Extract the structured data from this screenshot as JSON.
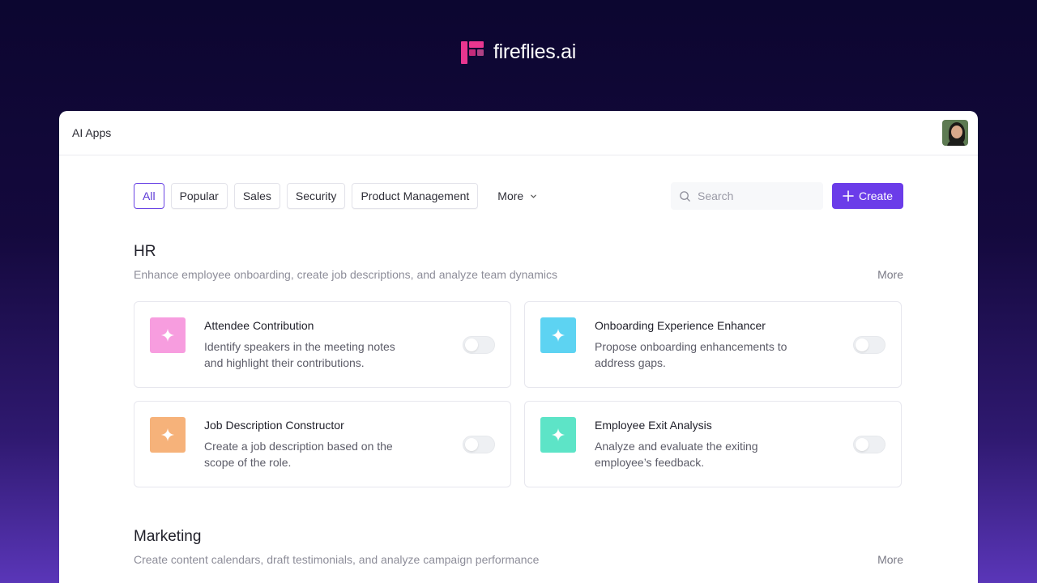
{
  "brand": {
    "name": "fireflies.ai",
    "color": "#e8368f"
  },
  "panel": {
    "title": "AI Apps"
  },
  "filters": {
    "chips": [
      {
        "label": "All",
        "active": true
      },
      {
        "label": "Popular",
        "active": false
      },
      {
        "label": "Sales",
        "active": false
      },
      {
        "label": "Security",
        "active": false
      },
      {
        "label": "Product Management",
        "active": false
      }
    ],
    "more_label": "More"
  },
  "search": {
    "placeholder": "Search",
    "value": ""
  },
  "create": {
    "label": "Create",
    "color": "#6b3ce9"
  },
  "sections": [
    {
      "title": "HR",
      "subtitle": "Enhance employee onboarding, create job descriptions, and analyze team dynamics",
      "more_label": "More",
      "apps": [
        {
          "title": "Attendee Contribution",
          "description": "Identify speakers in the meeting notes and highlight their contributions.",
          "icon": "sparkle-icon",
          "color": "#f79ddf",
          "enabled": false
        },
        {
          "title": "Onboarding Experience Enhancer",
          "description": "Propose onboarding enhancements to address gaps.",
          "icon": "sparkle-icon",
          "color": "#5dd3f2",
          "enabled": false
        },
        {
          "title": "Job Description Constructor",
          "description": "Create a job description based on the scope of the role.",
          "icon": "sparkle-icon",
          "color": "#f6b27a",
          "enabled": false
        },
        {
          "title": "Employee Exit Analysis",
          "description": "Analyze and evaluate the exiting employee’s feedback.",
          "icon": "sparkle-icon",
          "color": "#5de4c7",
          "enabled": false
        }
      ]
    },
    {
      "title": "Marketing",
      "subtitle": "Create content calendars, draft testimonials, and analyze campaign performance",
      "more_label": "More"
    }
  ]
}
